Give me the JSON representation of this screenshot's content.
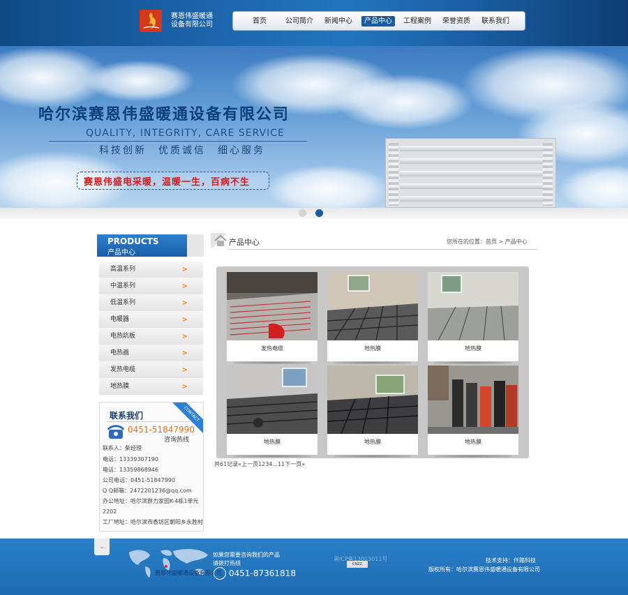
{
  "header": {
    "company_line1": "赛恩伟盛暖通",
    "company_line2": "设备有限公司",
    "nav": [
      "首页",
      "公司简介",
      "新闻中心",
      "产品中心",
      "工程案例",
      "荣誉资质",
      "联系我们"
    ],
    "active_nav": "产品中心",
    "colors": {
      "bar": "#1d66ad",
      "active": "#1a5a9a"
    }
  },
  "banner": {
    "title": "哈尔滨赛恩伟盛暖通设备有限公司",
    "english": "QUALITY, INTEGRITY, CARE SERVICE",
    "slogan": "科技创新　优质诚信　细心服务",
    "promo": "赛恩伟盛电采暖，温暖一生，百病不生",
    "slides": 2,
    "active_slide": 2
  },
  "sidebar": {
    "head_en": "PRODUCTS",
    "head_cn": "产品中心",
    "items": [
      {
        "label": "高温系列"
      },
      {
        "label": "中温系列"
      },
      {
        "label": "低温系列"
      },
      {
        "label": "电暖器"
      },
      {
        "label": "电热炕板"
      },
      {
        "label": "电热画"
      },
      {
        "label": "发热电缆"
      },
      {
        "label": "地热膜"
      }
    ],
    "chevron": ">"
  },
  "contact": {
    "title": "联系我们",
    "corner": "CONTACT",
    "hotline": "0451-51847990",
    "hotline_label": "咨询热线",
    "lines": [
      "联系人：柴经理",
      "电话：13339307190",
      "电话：13359868946",
      "公司电话：0451-51847990",
      "Q Q邮箱：2472201236@qq.com",
      "办公地址：哈尔滨群力家园K-4栋1单元",
      "2202",
      "工厂地址：哈尔滨市香坊区朝阳乡永胜村"
    ]
  },
  "main": {
    "title": "产品中心",
    "breadcrumb": "您所在的位置：首页 > 产品中心",
    "products": [
      {
        "caption": "发热电缆"
      },
      {
        "caption": "地热膜"
      },
      {
        "caption": "地热膜"
      },
      {
        "caption": "地热膜"
      },
      {
        "caption": "地热膜"
      },
      {
        "caption": "地热膜"
      }
    ],
    "pager": "共61记录«上一页1234...11下一页»"
  },
  "footer": {
    "toggle": "⌄",
    "map_company": "赛恩伟盛暖通设备有限公司",
    "consult_line1": "如果您需要咨询我们的产品",
    "consult_line2": "请拨打热线",
    "phone": "0451-87361818",
    "icp": "黑ICP备13003011号",
    "icp_badge": "CNZZ",
    "tech": "技术支持：仟路科技",
    "copyright": "版权所有：哈尔滨赛恩伟盛暖通设备有限公司"
  }
}
